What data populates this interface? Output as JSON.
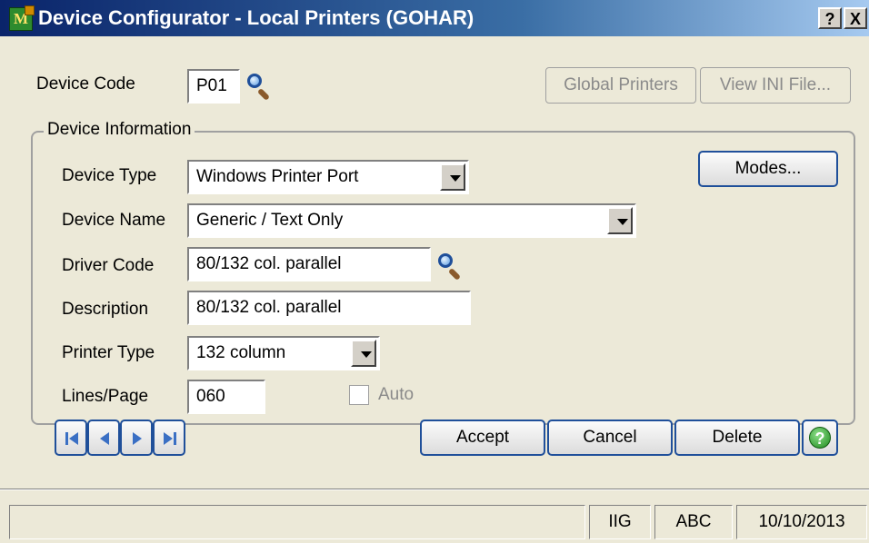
{
  "window": {
    "title": "Device Configurator - Local Printers (GOHAR)",
    "help_glyph": "?",
    "close_glyph": "X",
    "app_icon": "M"
  },
  "header": {
    "device_code_label": "Device Code",
    "device_code_value": "P01",
    "global_printers_label": "Global Printers",
    "view_ini_label": "View INI File..."
  },
  "device_info": {
    "group_label": "Device Information",
    "device_type_label": "Device Type",
    "device_type_value": "Windows Printer Port",
    "device_name_label": "Device Name",
    "device_name_value": "Generic / Text Only",
    "driver_code_label": "Driver Code",
    "driver_code_value": "80/132 col. parallel",
    "description_label": "Description",
    "description_value": "80/132 col. parallel",
    "printer_type_label": "Printer Type",
    "printer_type_value": "132 column",
    "lines_page_label": "Lines/Page",
    "lines_page_value": "060",
    "auto_label": "Auto",
    "auto_checked": false,
    "modes_label": "Modes..."
  },
  "nav_icons": [
    "first-record-icon",
    "previous-record-icon",
    "next-record-icon",
    "last-record-icon"
  ],
  "actions": {
    "accept_label": "Accept",
    "cancel_label": "Cancel",
    "delete_label": "Delete",
    "help_glyph": "?"
  },
  "statusbar": {
    "message": "",
    "company": "IIG",
    "module": "ABC",
    "date": "10/10/2013"
  },
  "colors": {
    "button_border": "#1f4f9a",
    "dialog_background": "#ece9d8",
    "title_gradient_start": "#0a246a"
  }
}
